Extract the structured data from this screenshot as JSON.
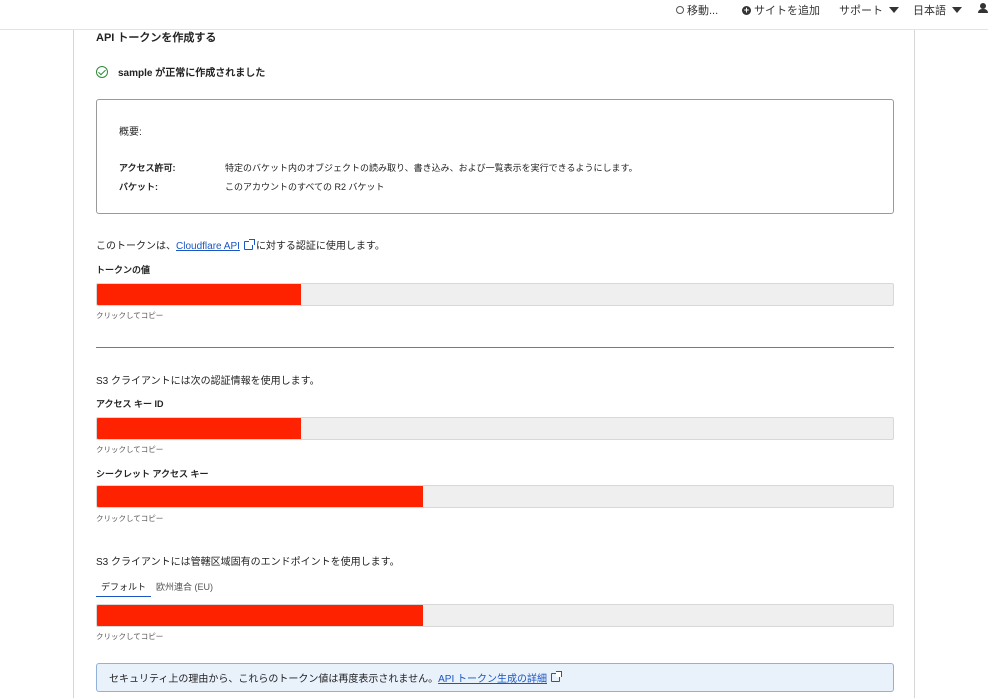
{
  "topbar": {
    "search": "移動...",
    "add_site": "サイトを追加",
    "support": "サポート",
    "language": "日本語"
  },
  "page": {
    "title": "API トークンを作成する",
    "success_message": "sample が正常に作成されました"
  },
  "summary": {
    "heading": "概要:",
    "rows": [
      {
        "label": "アクセス許可:",
        "value": "特定のバケット内のオブジェクトの読み取り、書き込み、および一覧表示を実行できるようにします。"
      },
      {
        "label": "バケット:",
        "value": "このアカウントのすべての R2 バケット"
      }
    ]
  },
  "token_section": {
    "desc_before": "このトークンは、",
    "link": "Cloudflare API",
    "desc_after": "に対する認証に使用します。",
    "label": "トークンの値",
    "hint": "クリックしてコピー"
  },
  "s3_section": {
    "desc": "S3 クライアントには次の認証情報を使用します。",
    "access_key_label": "アクセス キー ID",
    "access_key_hint": "クリックしてコピー",
    "secret_label": "シークレット アクセス キー",
    "secret_hint": "クリックしてコピー"
  },
  "endpoint_section": {
    "desc": "S3 クライアントには管轄区域固有のエンドポイントを使用します。",
    "tabs": [
      "デフォルト",
      "欧州連合 (EU)"
    ],
    "hint": "クリックしてコピー"
  },
  "notice": {
    "text": "セキュリティ上の理由から、これらのトークン値は再度表示されません。",
    "link": "API トークン生成の詳細"
  },
  "colors": {
    "redaction": "#ff2200",
    "link": "#1a56c4",
    "success": "#2f8a3c"
  }
}
